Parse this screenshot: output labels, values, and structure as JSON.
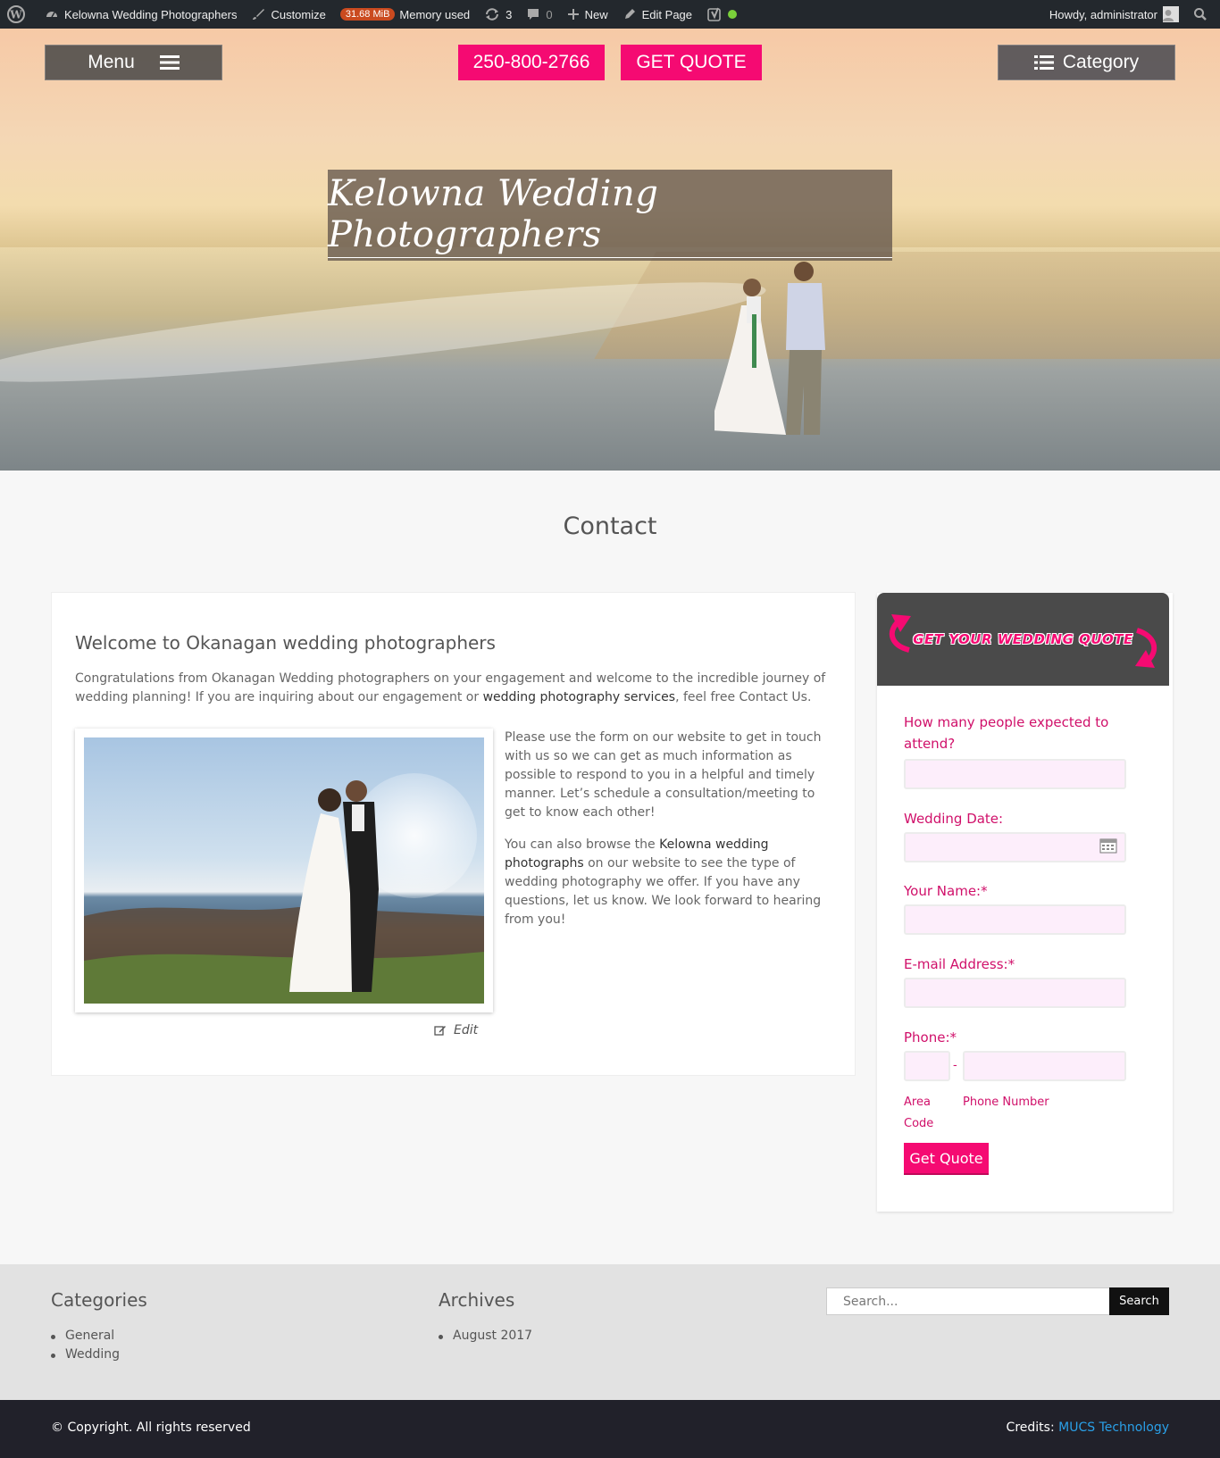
{
  "admin_bar": {
    "site_name": "Kelowna Wedding Photographers",
    "customize": "Customize",
    "memory_badge": "31.68 MiB",
    "memory_label": "Memory used",
    "updates_count": "3",
    "comments_count": "0",
    "new_label": "New",
    "edit_page": "Edit Page",
    "howdy": "Howdy, administrator"
  },
  "header": {
    "menu_label": "Menu",
    "phone": "250-800-2766",
    "quote_label": "GET QUOTE",
    "category_label": "Category",
    "site_title": "Kelowna Wedding Photographers"
  },
  "page": {
    "title": "Contact"
  },
  "content": {
    "heading": "Welcome to Okanagan wedding photographers",
    "intro_part1": "Congratulations from Okanagan Wedding photographers on your engagement and welcome to the incredible journey of wedding planning! If you are inquiring about our engagement or ",
    "intro_link": "wedding photography services",
    "intro_part2": ", feel free Contact Us.",
    "para2": "Please use the form on our website to get in touch with us so we can get as much information as possible to respond to you in a helpful and timely manner. Let’s schedule a consultation/meeting to get to know each other!",
    "para3_part1": "You can also browse the ",
    "para3_link": "Kelowna wedding photographs",
    "para3_part2": " on our website to see the type of wedding photography we offer. If you have any questions, let us know. We look forward to hearing from you!",
    "edit_label": "Edit"
  },
  "quote_form": {
    "banner": "GET YOUR WEDDING QUOTE",
    "people_label": "How many people expected to attend?",
    "date_label": "Wedding Date:",
    "name_label": "Your Name:*",
    "email_label": "E-mail Address:*",
    "phone_label": "Phone:*",
    "phone_separator": "-",
    "area_code_label": "Area Code",
    "phone_number_label": "Phone Number",
    "submit_label": "Get Quote"
  },
  "footer": {
    "categories_title": "Categories",
    "categories": [
      "General",
      "Wedding"
    ],
    "archives_title": "Archives",
    "archives": [
      "August 2017"
    ],
    "search_placeholder": "Search...",
    "search_button": "Search",
    "copyright": "© Copyright. All rights reserved",
    "credits_label": "Credits:",
    "credits_link": "MUCS Technology"
  },
  "colors": {
    "accent_pink": "#f50a72",
    "admin_bar": "#23282d",
    "footer_dark": "#21212a",
    "link_blue": "#2aa0e8"
  }
}
